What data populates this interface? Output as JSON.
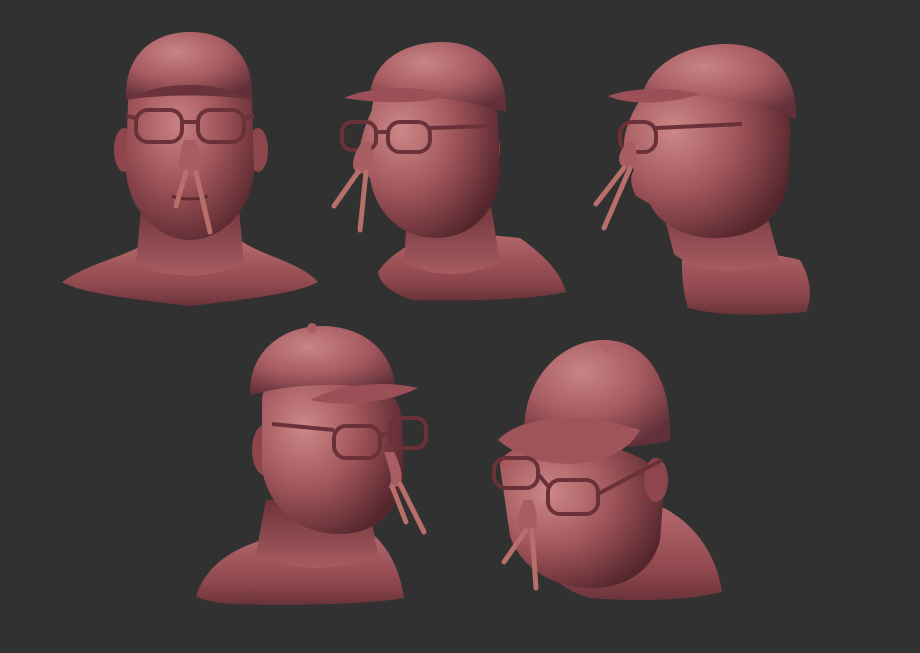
{
  "scene": {
    "background": "#313131",
    "clay_base": "#a0545a",
    "clay_light": "#c47a7c",
    "clay_shadow": "#5a2a30",
    "clay_dark": "#3e1c22",
    "stick_color": "#b86e6a"
  },
  "views": [
    {
      "name": "front-view"
    },
    {
      "name": "three-quarter-left-view"
    },
    {
      "name": "profile-left-view"
    },
    {
      "name": "three-quarter-right-low-view"
    },
    {
      "name": "top-down-view"
    }
  ]
}
